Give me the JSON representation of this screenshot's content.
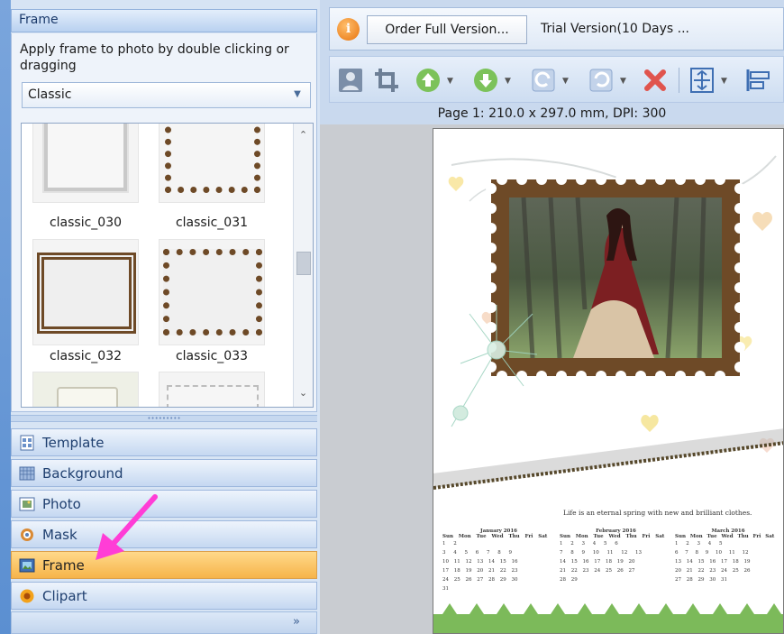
{
  "left_panel": {
    "title": "Frame",
    "instructions": "Apply frame to photo by double clicking or dragging",
    "style_select": {
      "value": "Classic",
      "icon": "chevron-down-icon"
    },
    "frames": [
      {
        "label": "",
        "style": "plain-grey"
      },
      {
        "label": "",
        "style": "brown-stamp"
      },
      {
        "label": "classic_030",
        "style": "plain-grey"
      },
      {
        "label": "classic_031",
        "style": "brown-stamp"
      },
      {
        "label": "classic_032",
        "style": "brown-pattern"
      },
      {
        "label": "classic_033",
        "style": "brown-stamp"
      },
      {
        "label": "",
        "style": "cream"
      },
      {
        "label": "",
        "style": "dashed"
      }
    ],
    "nav": [
      {
        "label": "Template",
        "icon": "template-icon"
      },
      {
        "label": "Background",
        "icon": "background-icon"
      },
      {
        "label": "Photo",
        "icon": "photo-icon"
      },
      {
        "label": "Mask",
        "icon": "mask-icon"
      },
      {
        "label": "Frame",
        "icon": "frame-icon",
        "active": true
      },
      {
        "label": "Clipart",
        "icon": "clipart-icon"
      }
    ],
    "more": "»"
  },
  "top_bar": {
    "order_button": "Order Full Version...",
    "trial_text": "Trial Version(10 Days ..."
  },
  "toolbar": {
    "buttons": [
      "person-icon",
      "crop-icon",
      "move-up-icon",
      "move-down-icon",
      "rotate-right-icon",
      "rotate-left-icon",
      "delete-icon",
      "fit-vertical-icon",
      "align-icon"
    ]
  },
  "canvas": {
    "page_info": "Page 1: 210.0 x 297.0 mm, DPI: 300",
    "caption": "Life is an eternal spring with new and brilliant clothes.",
    "calendar": {
      "months": [
        {
          "name": "January   2016",
          "weeks": [
            "1 2",
            "3 4 5 6 7 8 9",
            "10 11 12 13 14 15 16",
            "17 18 19 20 21 22 23",
            "24 25 26 27 28 29 30",
            "31"
          ]
        },
        {
          "name": "February   2016",
          "weeks": [
            "1 2 3 4 5 6",
            "7 8 9 10 11 12 13",
            "14 15 16 17 18 19 20",
            "21 22 23 24 25 26 27",
            "28 29"
          ]
        },
        {
          "name": "March   2016",
          "weeks": [
            "1 2 3 4 5",
            "6 7 8 9 10 11 12",
            "13 14 15 16 17 18 19",
            "20 21 22 23 24 25 26",
            "27 28 29 30 31"
          ]
        }
      ],
      "weekdays": "Sun Mon Tue Wed Thu Fri Sat"
    }
  },
  "colors": {
    "accent": "#f6b44a",
    "frame_brown": "#6e4a27",
    "panel": "#d7e4f4"
  }
}
